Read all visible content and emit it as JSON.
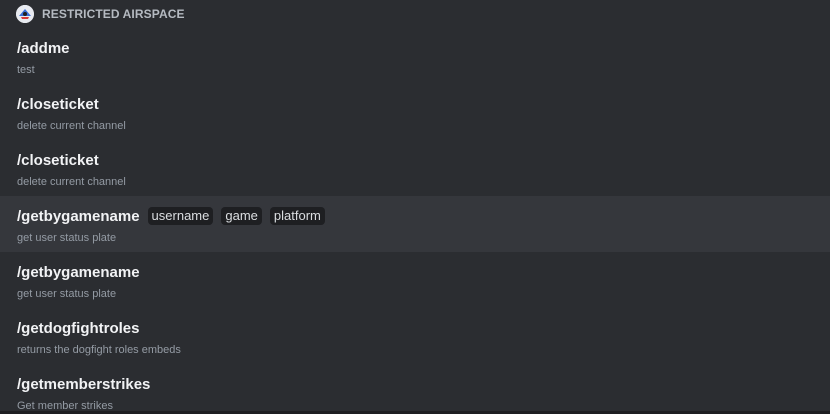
{
  "section": {
    "title": "RESTRICTED AIRSPACE",
    "icon": "app-avatar-icon"
  },
  "commands": [
    {
      "name": "/addme",
      "description": "test",
      "options": []
    },
    {
      "name": "/closeticket",
      "description": "delete current channel",
      "options": []
    },
    {
      "name": "/closeticket",
      "description": "delete current channel",
      "options": []
    },
    {
      "name": "/getbygamename",
      "description": "get user status plate",
      "options": [
        "username",
        "game",
        "platform"
      ],
      "selected": true
    },
    {
      "name": "/getbygamename",
      "description": "get user status plate",
      "options": []
    },
    {
      "name": "/getdogfightroles",
      "description": "returns the dogfight roles embeds",
      "options": []
    },
    {
      "name": "/getmemberstrikes",
      "description": "Get member strikes",
      "options": []
    }
  ],
  "colors": {
    "background": "#2b2d31",
    "selected_row": "#35373c",
    "option_chip": "#1e1f22",
    "command_text": "#f2f3f5",
    "description_text": "#949ba4"
  }
}
